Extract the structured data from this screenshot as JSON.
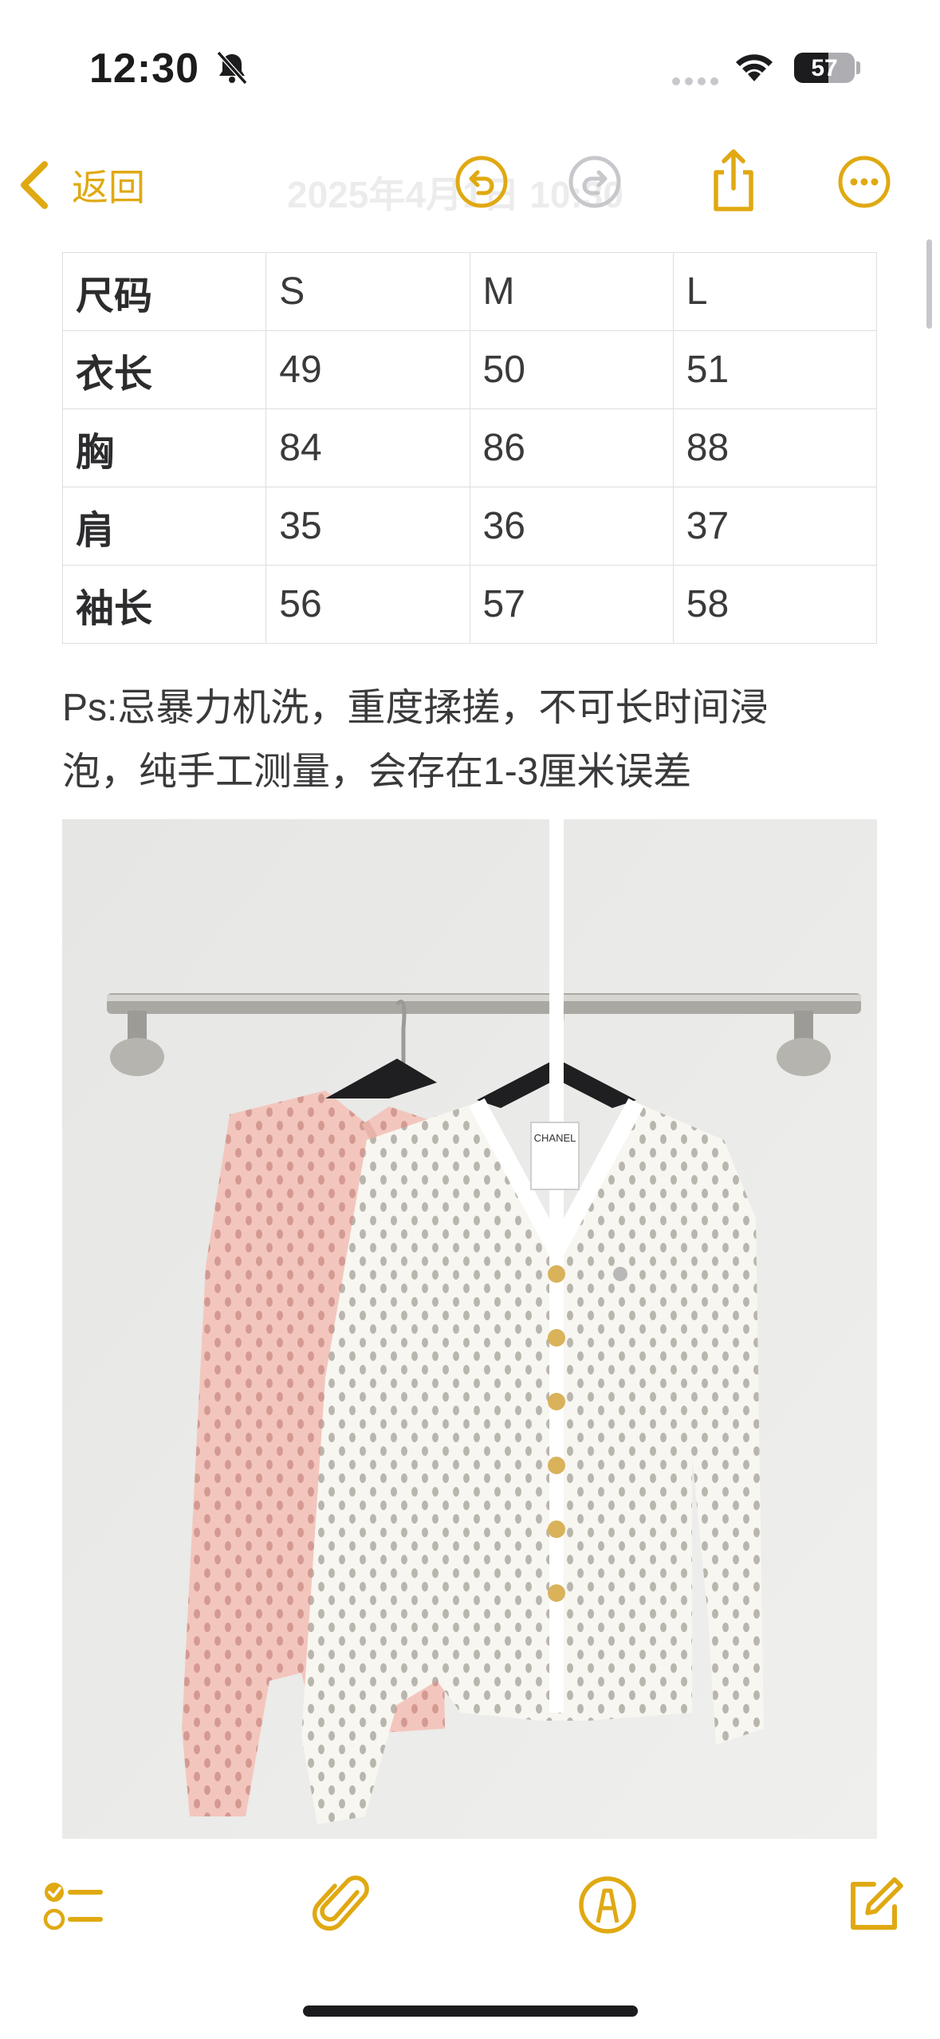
{
  "status_bar": {
    "time": "12:30",
    "battery_level": "57",
    "icons": [
      "bell-slash-icon",
      "cellular-dots-icon",
      "wifi-icon",
      "battery-icon"
    ]
  },
  "nav": {
    "back_label": "返回",
    "title": "2025年4月1日 10:30",
    "icons": [
      "chevron-left-icon",
      "undo-icon",
      "redo-icon",
      "share-icon",
      "more-icon"
    ],
    "accent_color": "#e0a912"
  },
  "size_table": {
    "header": [
      "尺码",
      "S",
      "M",
      "L"
    ],
    "rows": [
      [
        "衣长",
        "49",
        "50",
        "51"
      ],
      [
        "胸",
        "84",
        "86",
        "88"
      ],
      [
        "肩",
        "35",
        "36",
        "37"
      ],
      [
        "袖长",
        "56",
        "57",
        "58"
      ]
    ]
  },
  "note": {
    "line1": "Ps:忌暴力机洗，重度揉搓，不可长时间浸",
    "line2": "泡，纯手工测量，会存在1-3厘米误差"
  },
  "photo": {
    "tag_text": "CHANEL",
    "colors": {
      "wall": "#e9e9e7",
      "pink_cardigan": "#f3c6bd",
      "white_cardigan": "#f7f6f1",
      "buttons": "#d9b25a"
    }
  },
  "toolbar": {
    "icons": [
      "checklist-icon",
      "paperclip-icon",
      "markup-pen-icon",
      "compose-icon"
    ]
  }
}
